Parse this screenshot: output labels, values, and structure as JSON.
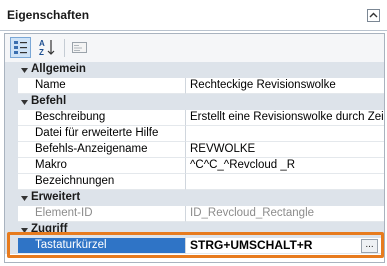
{
  "panel": {
    "title": "Eigenschaften"
  },
  "toolbar": {
    "buttons": [
      {
        "icon": "categorized-view-icon",
        "active": true
      },
      {
        "icon": "sort-alphabetical-icon",
        "active": false
      },
      {
        "icon": "property-pages-icon",
        "active": false
      }
    ]
  },
  "grid": {
    "categories": [
      {
        "label": "Allgemein"
      },
      {
        "label": "Befehl"
      },
      {
        "label": "Erweitert"
      },
      {
        "label": "Zugriff"
      }
    ],
    "rows": {
      "name": {
        "label": "Name",
        "value": "Rechteckige Revisionswolke"
      },
      "beschreibung": {
        "label": "Beschreibung",
        "value": "Erstellt eine Revisionswolke durch Zeich"
      },
      "hilfedatei": {
        "label": "Datei für erweiterte Hilfe",
        "value": ""
      },
      "anzeigename": {
        "label": "Befehls-Anzeigename",
        "value": "REVWOLKE"
      },
      "makro": {
        "label": "Makro",
        "value": "^C^C_^Revcloud _R"
      },
      "bezeichnungen": {
        "label": "Bezeichnungen",
        "value": ""
      },
      "element_id": {
        "label": "Element-ID",
        "value": "ID_Revcloud_Rectangle"
      },
      "tastaturkuerzel": {
        "label": "Tastaturkürzel",
        "value": "STRG+UMSCHALT+R",
        "button": "..."
      }
    }
  },
  "colors": {
    "selection": "#2f74c6",
    "highlight_border": "#e77b1e",
    "category_bg": "#dde3ea"
  }
}
